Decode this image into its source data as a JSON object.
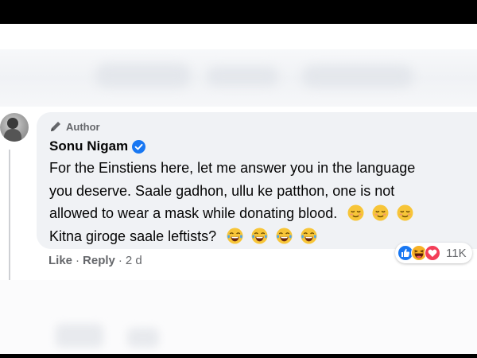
{
  "comment": {
    "author_badge": "Author",
    "name": "Sonu Nigam",
    "line_1": "For the Einstiens here, let me answer you in the language",
    "line_2": "you deserve. Saale gadhon, ullu ke patthon, one is not",
    "line_3": "allowed to wear a mask while donating blood.",
    "line_4": "Kitna giroge saale leftists?",
    "actions": {
      "like": "Like",
      "reply": "Reply",
      "separator": "·",
      "time": "2 d"
    },
    "reactions": {
      "icons": [
        "like-icon",
        "haha-icon",
        "love-icon"
      ],
      "count": "11K"
    }
  },
  "colors": {
    "bubble": "#f0f2f5",
    "verified": "#1877f2",
    "like": "#1877f2",
    "love": "#f33e58",
    "secondary_text": "#65676b"
  }
}
